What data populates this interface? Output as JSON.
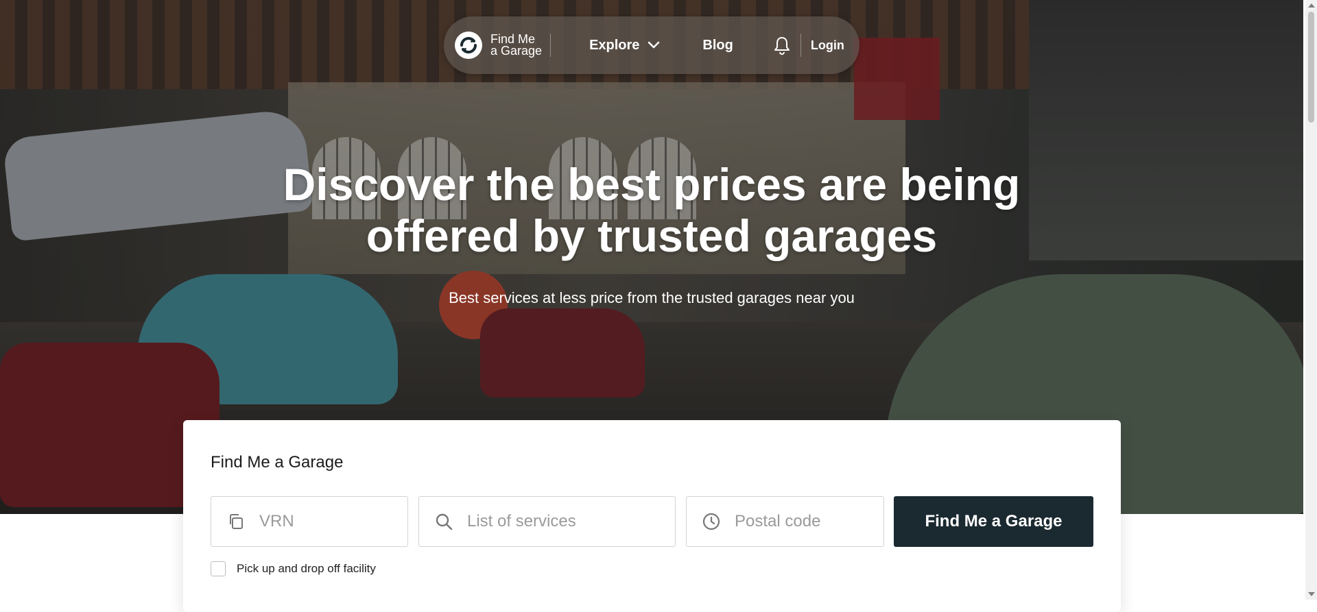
{
  "nav": {
    "logo_line1": "Find Me",
    "logo_line2": "a Garage",
    "explore": "Explore",
    "blog": "Blog",
    "login": "Login",
    "icons": [
      "logo-icon",
      "chevron-down-icon",
      "bell-icon"
    ]
  },
  "hero": {
    "headline": "Discover the best prices are being offered by trusted garages",
    "subhead": "Best services at less price from the trusted garages near you"
  },
  "search": {
    "title": "Find Me a Garage",
    "vrn_placeholder": "VRN",
    "services_placeholder": "List of services",
    "postal_placeholder": "Postal code",
    "button": "Find Me a Garage",
    "pickup_label": "Pick up and drop off facility",
    "pickup_checked": false
  },
  "colors": {
    "button_bg": "#1b2a30",
    "nav_bg": "#5f5850",
    "text_white": "#ffffff"
  }
}
